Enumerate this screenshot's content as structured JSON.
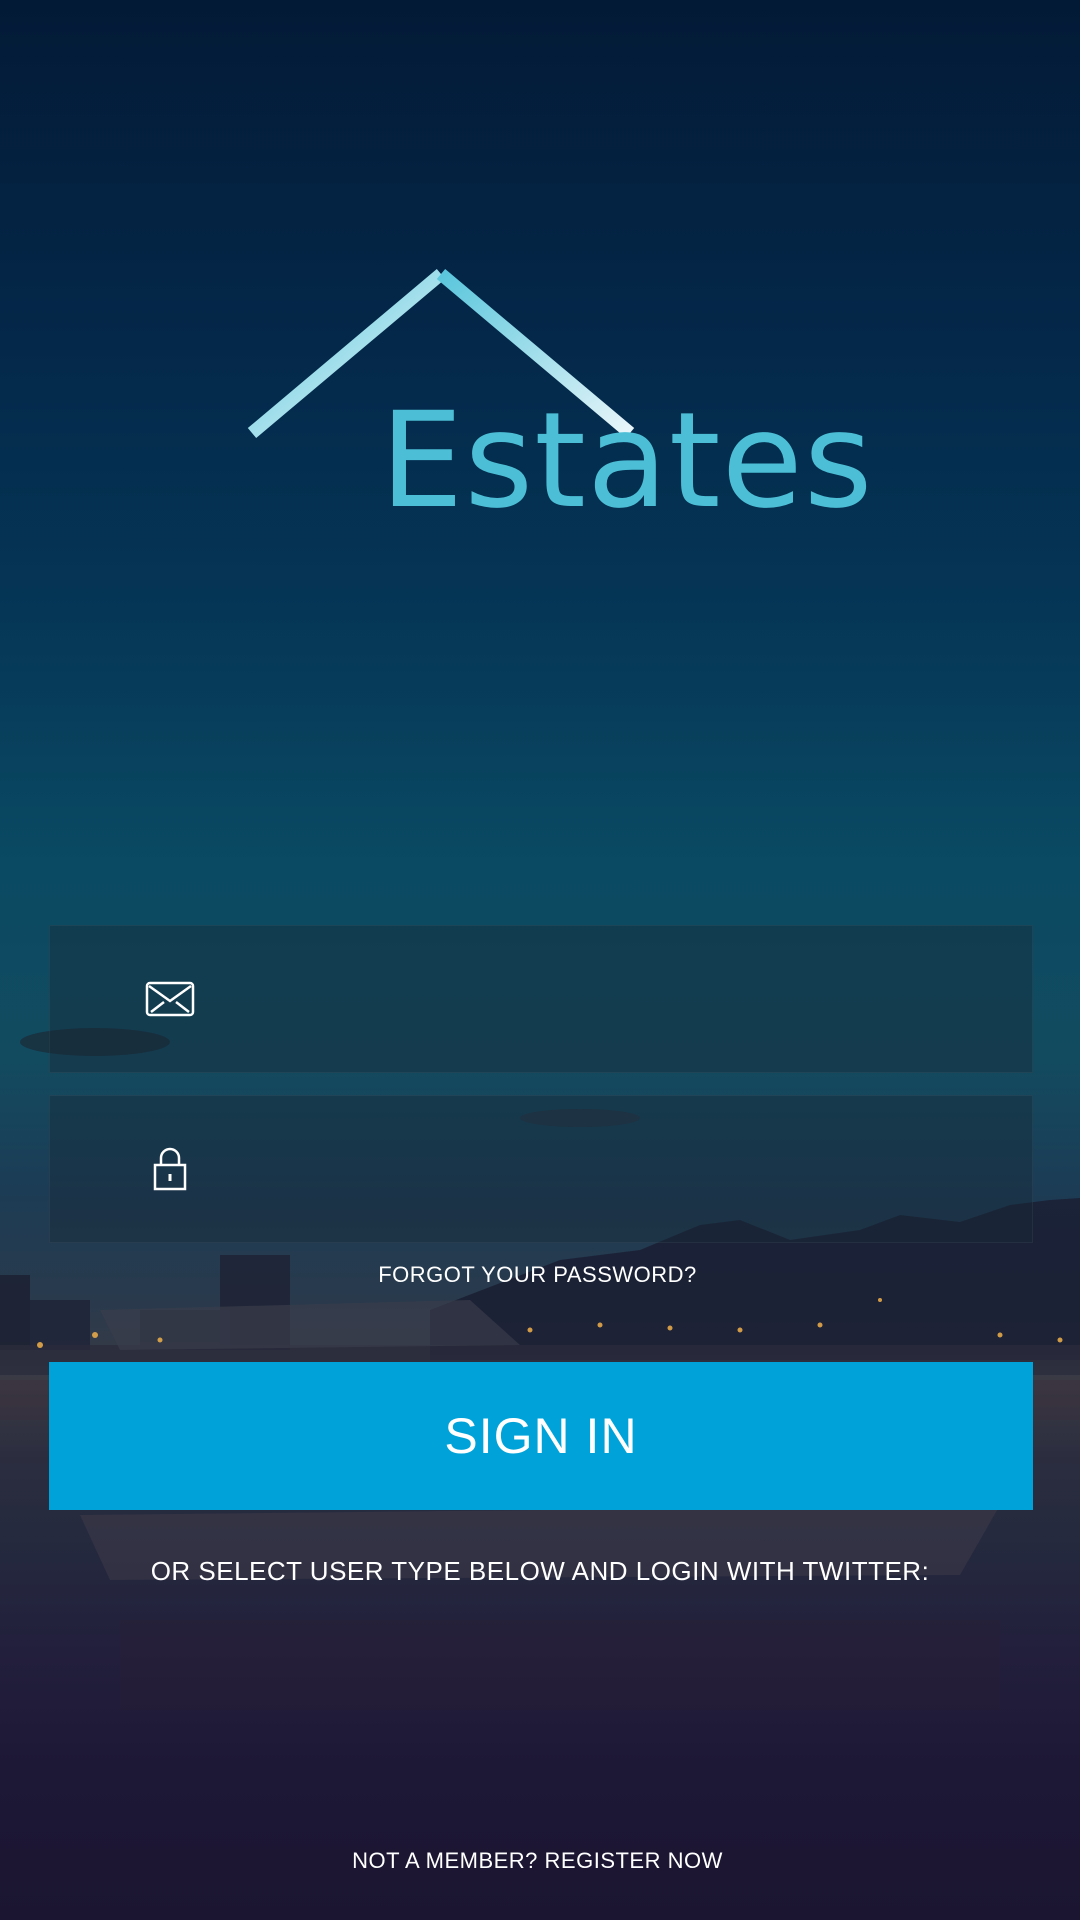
{
  "brand": {
    "name": "Estates",
    "logo_color": "#4cbfd6"
  },
  "login_form": {
    "email_field": {
      "icon": "envelope-icon",
      "value": "",
      "placeholder": ""
    },
    "password_field": {
      "icon": "lock-icon",
      "value": "",
      "placeholder": ""
    },
    "forgot_password_label": "FORGOT YOUR PASSWORD?",
    "sign_in_label": "SIGN IN",
    "sign_in_color": "#00a3d9"
  },
  "social": {
    "prompt": "OR SELECT USER TYPE BELOW AND LOGIN WITH TWITTER:"
  },
  "footer": {
    "register_label": "NOT A MEMBER? REGISTER NOW"
  }
}
